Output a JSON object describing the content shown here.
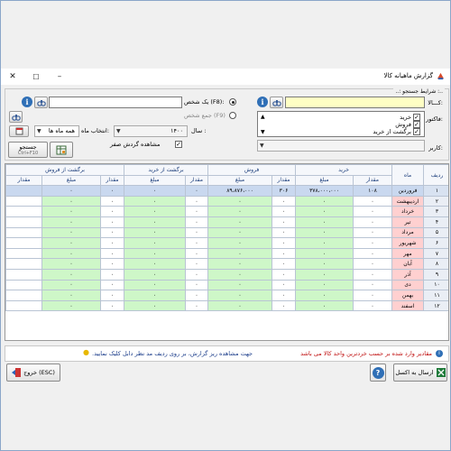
{
  "window": {
    "title": "گزارش ماهیانه کالا",
    "controls": {
      "minimize": "–",
      "maximize": "☐",
      "close": "✕"
    }
  },
  "criteria": {
    "group_title": "..: شرایط جستجو :..",
    "goods_label": "کـــالا:",
    "person_radio_label": "یک شخص (F8):",
    "all_persons_radio_label": "جمع شخص (F9)",
    "factor_label": "فاکتور:",
    "factor_types": [
      {
        "label": "خرید",
        "checked": true
      },
      {
        "label": "فروش",
        "checked": true
      },
      {
        "label": "برگشت از خرید",
        "checked": true
      }
    ],
    "year_label": "سال :",
    "year_value": "۱۴۰۰",
    "month_select_label": "انتخاب ماه:",
    "month_select_value": "همه ماه ها",
    "zero_turnover_label": "مشاهده گردش صفر",
    "zero_turnover_checked": true,
    "user_label": "کاربر:",
    "search_button_label": "جستجو",
    "search_button_sub": "Ctrl+F10"
  },
  "grid": {
    "headers_top": {
      "row": "ردیف",
      "month": "ماه",
      "buy": "خرید",
      "sell": "فروش",
      "buy_return": "برگشت از خرید",
      "sell_return": "برگشت از فروش"
    },
    "sub_amount": "مقدار",
    "sub_price": "مبلغ",
    "rows": [
      {
        "n": "۱",
        "m": "فروردین",
        "v": [
          "۱۰۸",
          "۳۷۸،۰۰۰،۰۰۰",
          "۳۰۶",
          "۸۹،۸۷۶،۰۰۰",
          "۰",
          "۰",
          "۰",
          "۰"
        ]
      },
      {
        "n": "۲",
        "m": "اردیبهشت",
        "v": [
          "۰",
          "۰",
          "۰",
          "۰",
          "۰",
          "۰",
          "۰",
          "۰"
        ]
      },
      {
        "n": "۳",
        "m": "خرداد",
        "v": [
          "۰",
          "۰",
          "۰",
          "۰",
          "۰",
          "۰",
          "۰",
          "۰"
        ]
      },
      {
        "n": "۴",
        "m": "تیر",
        "v": [
          "۰",
          "۰",
          "۰",
          "۰",
          "۰",
          "۰",
          "۰",
          "۰"
        ]
      },
      {
        "n": "۵",
        "m": "مرداد",
        "v": [
          "۰",
          "۰",
          "۰",
          "۰",
          "۰",
          "۰",
          "۰",
          "۰"
        ]
      },
      {
        "n": "۶",
        "m": "شهریور",
        "v": [
          "۰",
          "۰",
          "۰",
          "۰",
          "۰",
          "۰",
          "۰",
          "۰"
        ]
      },
      {
        "n": "۷",
        "m": "مهر",
        "v": [
          "۰",
          "۰",
          "۰",
          "۰",
          "۰",
          "۰",
          "۰",
          "۰"
        ]
      },
      {
        "n": "۸",
        "m": "آبان",
        "v": [
          "۰",
          "۰",
          "۰",
          "۰",
          "۰",
          "۰",
          "۰",
          "۰"
        ]
      },
      {
        "n": "۹",
        "m": "آذر",
        "v": [
          "۰",
          "۰",
          "۰",
          "۰",
          "۰",
          "۰",
          "۰",
          "۰"
        ]
      },
      {
        "n": "۱۰",
        "m": "دی",
        "v": [
          "۰",
          "۰",
          "۰",
          "۰",
          "۰",
          "۰",
          "۰",
          "۰"
        ]
      },
      {
        "n": "۱۱",
        "m": "بهمن",
        "v": [
          "۰",
          "۰",
          "۰",
          "۰",
          "۰",
          "۰",
          "۰",
          "۰"
        ]
      },
      {
        "n": "۱۲",
        "m": "اسفند",
        "v": [
          "۰",
          "۰",
          "۰",
          "۰",
          "۰",
          "۰",
          "۰",
          "۰"
        ]
      }
    ],
    "green_color": "#cef7c8",
    "selected_row_color": "#c9d8ef",
    "month_cell_color": "#ffd0d0"
  },
  "hint": {
    "text1": "مقادیر وارد شده بر حسب خردترین واحد کالا می باشد",
    "text2": "جهت مشاهده ریز گزارش، بر روی ردیف مد نظر دابل کلیک نمایید."
  },
  "footer": {
    "excel_label": "ارسال به اکسل",
    "exit_label": "خروج (ESC)",
    "help_label": "?"
  }
}
